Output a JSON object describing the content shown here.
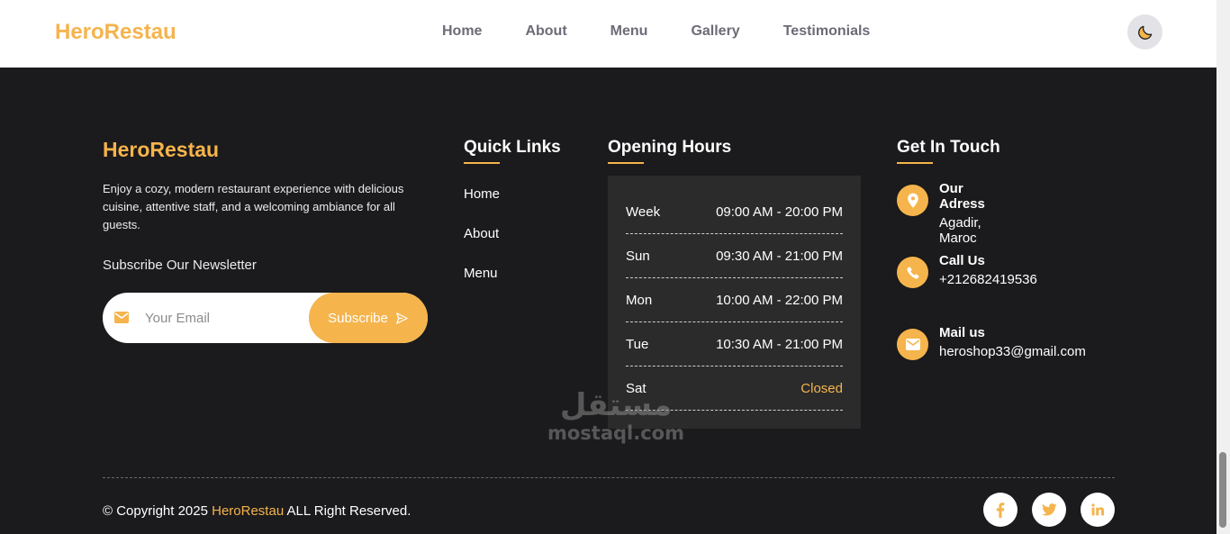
{
  "navbar": {
    "logo": "HeroRestau",
    "links": [
      "Home",
      "About",
      "Menu",
      "Gallery",
      "Testimonials"
    ],
    "theme_icon": "moon-icon"
  },
  "footer": {
    "brand": {
      "title": "HeroRestau",
      "description": "Enjoy a cozy, modern restaurant experience with delicious cuisine, attentive staff, and a welcoming ambiance for all guests.",
      "newsletter_title": "Subscribe Our Newsletter",
      "email_placeholder": "Your Email",
      "subscribe_label": "Subscribe"
    },
    "quick_links": {
      "title": "Quick Links",
      "items": [
        "Home",
        "About",
        "Menu"
      ]
    },
    "opening_hours": {
      "title": "Opening Hours",
      "rows": [
        {
          "day": "Week",
          "time": "09:00 AM - 20:00 PM"
        },
        {
          "day": "Sun",
          "time": "09:30 AM - 21:00 PM"
        },
        {
          "day": "Mon",
          "time": "10:00 AM - 22:00 PM"
        },
        {
          "day": "Tue",
          "time": "10:30 AM - 21:00 PM"
        },
        {
          "day": "Sat",
          "time": "Closed"
        }
      ]
    },
    "contact": {
      "title": "Get In Touch",
      "items": [
        {
          "label": "Our Adress",
          "value": "Agadir, Maroc",
          "icon": "map-pin-icon"
        },
        {
          "label": "Call Us",
          "value": "+212682419536",
          "icon": "phone-icon"
        },
        {
          "label": "Mail us",
          "value": "heroshop33@gmail.com",
          "icon": "envelope-icon"
        }
      ]
    },
    "copyright": {
      "prefix": "© Copyright 2025 ",
      "brand": "HeroRestau",
      "suffix": " ALL Right Reserved."
    },
    "socials": [
      "facebook-icon",
      "twitter-icon",
      "linkedin-icon"
    ]
  },
  "watermark": {
    "arabic": "مستقل",
    "latin": "mostaql.com"
  },
  "colors": {
    "accent": "#f5b44c",
    "footer_bg": "#1b1a1c",
    "hours_bg": "#2b2b2b"
  }
}
